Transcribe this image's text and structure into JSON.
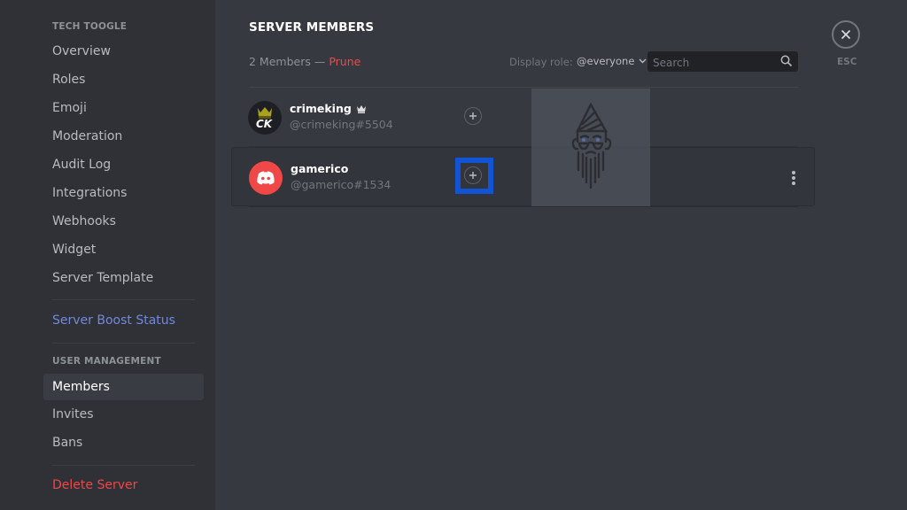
{
  "sidebar": {
    "server_header": "TECH TOOGLE",
    "items": [
      {
        "label": "Overview"
      },
      {
        "label": "Roles"
      },
      {
        "label": "Emoji"
      },
      {
        "label": "Moderation"
      },
      {
        "label": "Audit Log"
      },
      {
        "label": "Integrations"
      },
      {
        "label": "Webhooks"
      },
      {
        "label": "Widget"
      },
      {
        "label": "Server Template"
      }
    ],
    "boost": {
      "label": "Server Boost Status",
      "color": "#7289da"
    },
    "user_management_header": "USER MANAGEMENT",
    "user_items": [
      {
        "label": "Members",
        "active": true
      },
      {
        "label": "Invites"
      },
      {
        "label": "Bans"
      }
    ],
    "delete": {
      "label": "Delete Server",
      "color": "#f04747"
    }
  },
  "main": {
    "title": "SERVER MEMBERS",
    "member_count": "2 Members",
    "separator": " — ",
    "prune_label": "Prune",
    "display_role_label": "Display role:",
    "display_role_value": "@everyone",
    "search_placeholder": "Search",
    "members": [
      {
        "name": "crimeking",
        "tag": "@crimeking#5504",
        "owner": true,
        "avatar_text": "CK",
        "avatar_icon": "crown-icon"
      },
      {
        "name": "gamerico",
        "tag": "@gamerico#1534",
        "owner": false,
        "avatar_icon": "discord-logo-icon",
        "avatar_color": "#f04747"
      }
    ],
    "close_label": "ESC"
  },
  "colors": {
    "highlight_box": "#1155d6",
    "danger": "#f04747",
    "brand": "#7289da"
  }
}
